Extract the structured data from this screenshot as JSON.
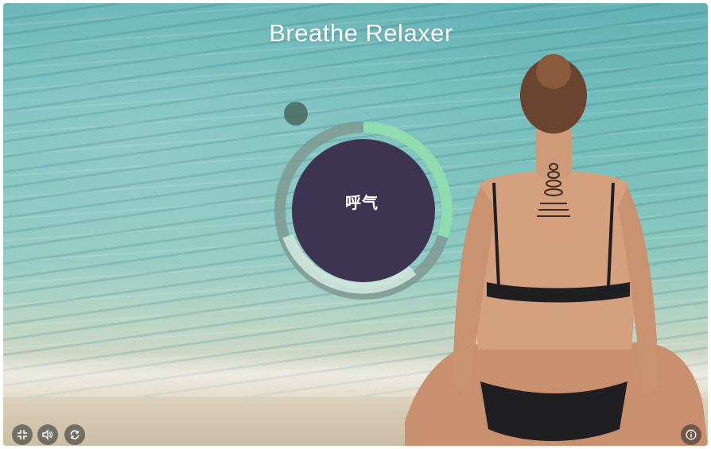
{
  "app": {
    "title": "Breathe Relaxer"
  },
  "breathing": {
    "phase_label": "呼气",
    "progress": 0.3
  },
  "controls": {
    "bottom_left": [
      {
        "icon": "fullscreen-icon"
      },
      {
        "icon": "volume-icon"
      },
      {
        "icon": "refresh-icon"
      }
    ],
    "bottom_right": [
      {
        "icon": "info-icon"
      }
    ]
  },
  "colors": {
    "ring_progress": "#8fdcb0",
    "ring_track": "#7e9a93",
    "ring_light": "#cfe6dc",
    "core": "#3c3450",
    "dot": "#4d6e67"
  }
}
